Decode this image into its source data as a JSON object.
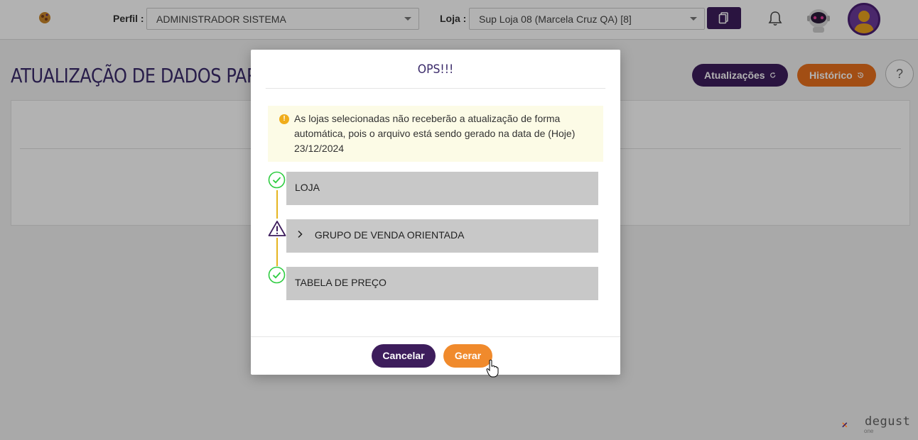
{
  "header": {
    "profile_label": "Perfil :",
    "profile_value": "ADMINISTRADOR SISTEMA",
    "store_label": "Loja :",
    "store_value": "Sup Loja 08 (Marcela Cruz QA) [8]"
  },
  "page": {
    "title": "ATUALIZAÇÃO DE DADOS PARA",
    "updates_button": "Atualizações",
    "history_button": "Histórico",
    "help_button": "?"
  },
  "modal": {
    "title": "OPS!!!",
    "alert_text": "As lojas selecionadas não receberão a atualização de forma automática, pois o arquivo está sendo gerado na data de (Hoje) 23/12/2024",
    "steps": [
      {
        "label": "LOJA",
        "status": "ok"
      },
      {
        "label": "GRUPO DE VENDA ORIENTADA",
        "status": "warning",
        "expandable": true
      },
      {
        "label": "TABELA DE PREÇO",
        "status": "ok"
      }
    ],
    "cancel_button": "Cancelar",
    "generate_button": "Gerar"
  },
  "brand": {
    "name": "degust",
    "sub": "one"
  },
  "colors": {
    "primary": "#3d1d5c",
    "accent": "#e8701e",
    "ok": "#2ecc40",
    "warning": "#f0ad1b"
  }
}
